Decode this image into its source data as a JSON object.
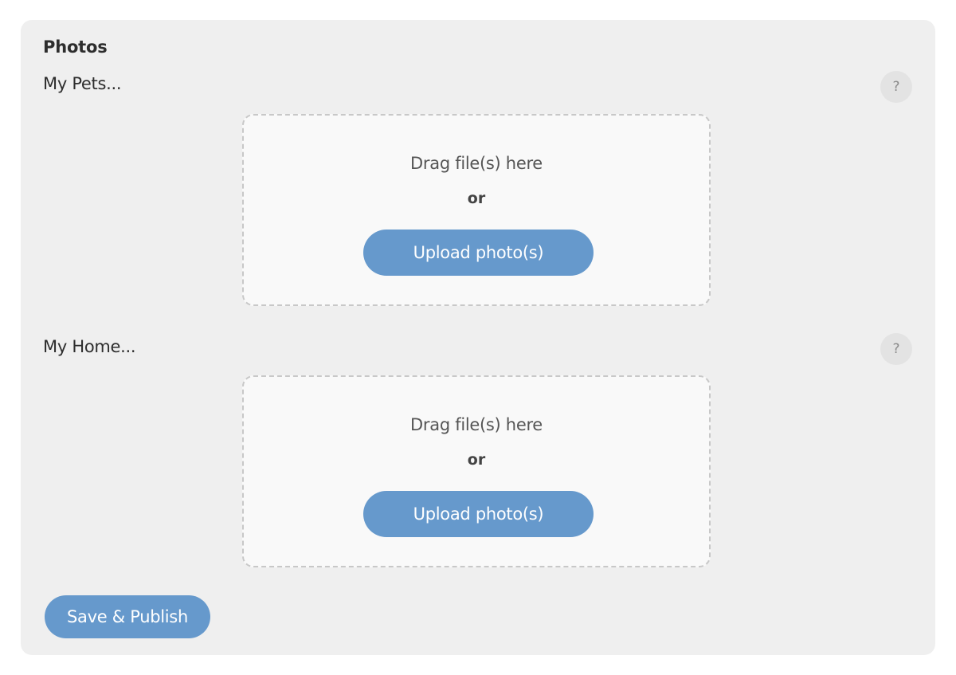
{
  "section": {
    "title": "Photos"
  },
  "groups": [
    {
      "label": "My Pets...",
      "help_label": "?",
      "dropzone": {
        "drag_text": "Drag file(s) here",
        "or_text": "or",
        "upload_label": "Upload photo(s)"
      }
    },
    {
      "label": "My Home...",
      "help_label": "?",
      "dropzone": {
        "drag_text": "Drag file(s) here",
        "or_text": "or",
        "upload_label": "Upload photo(s)"
      }
    }
  ],
  "actions": {
    "save_label": "Save & Publish"
  },
  "colors": {
    "panel_bg": "#efefef",
    "button_bg": "#6699cc",
    "dropzone_bg": "#f9f9f9",
    "dropzone_border": "#c8c8c8"
  }
}
